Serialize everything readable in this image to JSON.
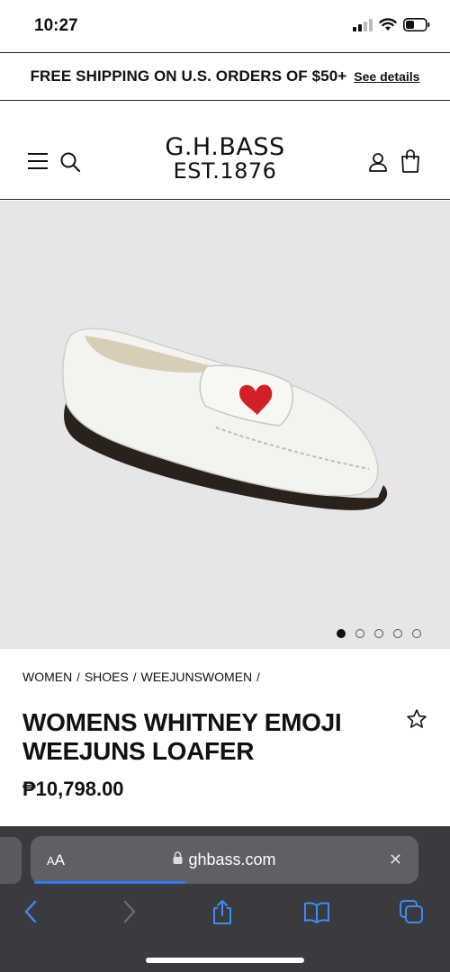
{
  "status_bar": {
    "time": "10:27"
  },
  "promo": {
    "text": "FREE SHIPPING ON U.S. ORDERS OF $50+",
    "link": "See details"
  },
  "header": {
    "logo_line1": "G.H.BASS",
    "logo_line2": "EST.1876"
  },
  "gallery": {
    "image_count": 5,
    "active_index": 0
  },
  "breadcrumbs": [
    "WOMEN",
    "SHOES",
    "WEEJUNSWOMEN"
  ],
  "breadcrumb_separator": "/",
  "product": {
    "title": "WOMENS WHITNEY EMOJI WEEJUNS LOAFER",
    "price": "₱10,798.00"
  },
  "browser": {
    "aa_label_small": "A",
    "aa_label_large": "A",
    "url": "ghbass.com",
    "close_label": "✕",
    "load_progress": 0.39
  },
  "colors": {
    "accent": "#2f7cf6",
    "toolbar_bg": "#3a3b3e",
    "gallery_bg": "#e6e6e8"
  }
}
